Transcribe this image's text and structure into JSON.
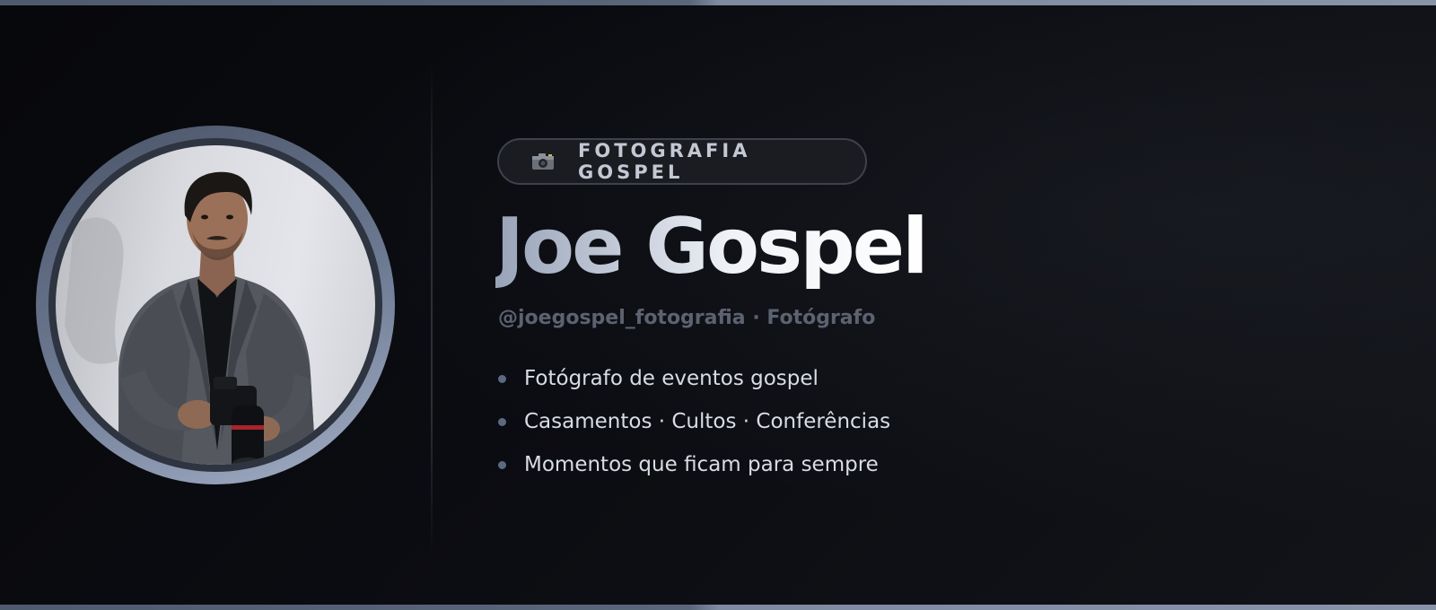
{
  "profile": {
    "badge_label": "FOTOGRAFIA GOSPEL",
    "badge_icon": "camera-icon",
    "name": "Joe Gospel",
    "handle": "@joegospel_fotografia · Fotógrafo",
    "features": [
      "Fotógrafo de eventos gospel",
      "Casamentos · Cultos · Conferências",
      "Momentos que ficam para sempre"
    ],
    "avatar_alt": "photographer-portrait"
  },
  "colors": {
    "background": "#090a0e",
    "accent": "#7d8aa0",
    "badge_border": "#3d424c",
    "handle": "#5c6270",
    "bullet": "#5c6a80"
  }
}
